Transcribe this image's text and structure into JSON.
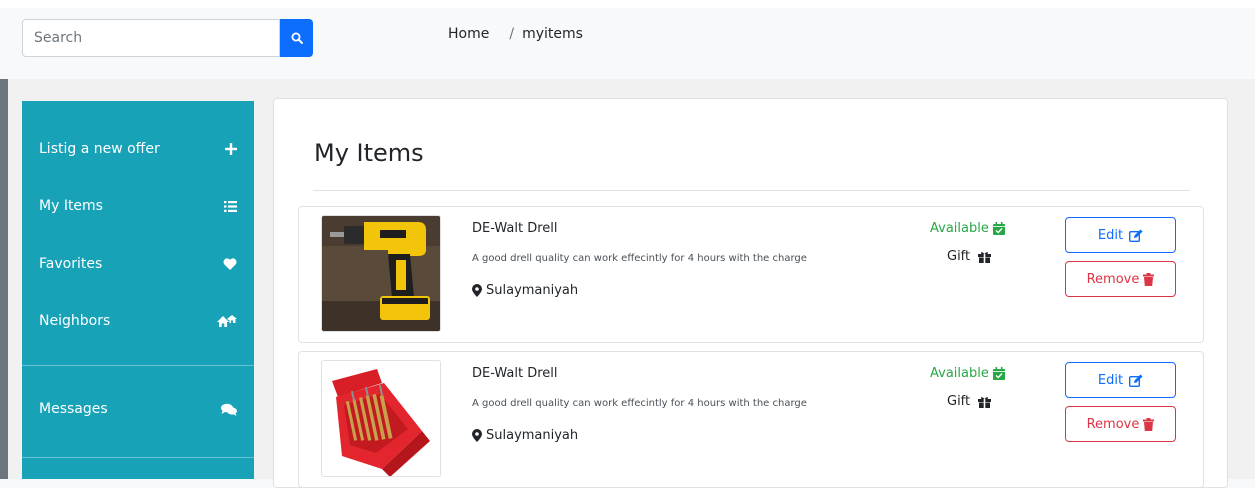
{
  "search": {
    "placeholder": "Search"
  },
  "breadcrumb": {
    "home": "Home",
    "separator": "/",
    "current": "myitems"
  },
  "sidebar": {
    "items": [
      {
        "label": "Listig a new offer",
        "icon": "plus-icon"
      },
      {
        "label": "My Items",
        "icon": "list-icon"
      },
      {
        "label": "Favorites",
        "icon": "heart-icon"
      },
      {
        "label": "Neighbors",
        "icon": "houses-icon"
      },
      {
        "label": "Messages",
        "icon": "comments-icon"
      }
    ]
  },
  "main": {
    "title": "My Items",
    "items": [
      {
        "name": "DE-Walt Drell",
        "description": "A good drell quality can work effecintly for 4 hours with the charge",
        "location": "Sulaymaniyah",
        "status": "Available",
        "type": "Gift",
        "edit_label": "Edit",
        "remove_label": "Remove",
        "image": "drill-photo"
      },
      {
        "name": "DE-Walt Drell",
        "description": "A good drell quality can work effecintly for 4 hours with the charge",
        "location": "Sulaymaniyah",
        "status": "Available",
        "type": "Gift",
        "edit_label": "Edit",
        "remove_label": "Remove",
        "image": "drill-bit-set-photo"
      }
    ]
  },
  "colors": {
    "sidebar": "#17a2b8",
    "primary": "#0d6efd",
    "danger": "#dc3545",
    "success": "#28a745"
  }
}
